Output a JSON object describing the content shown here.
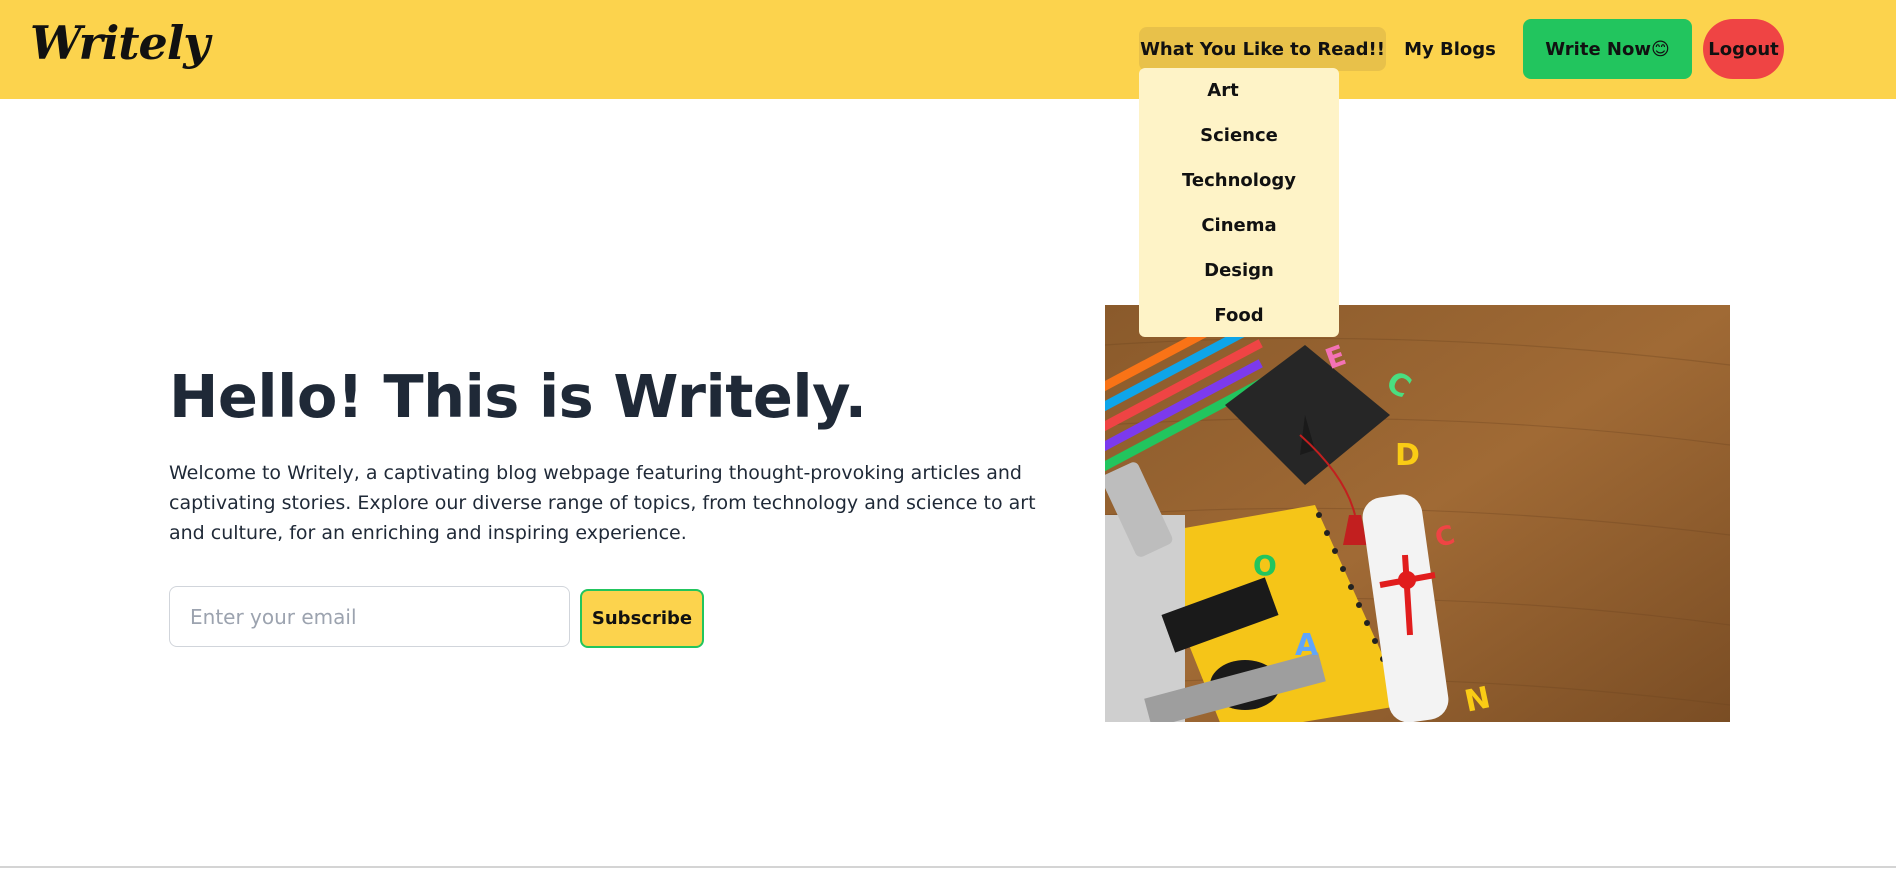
{
  "navbar": {
    "logo": "Writely",
    "dropdown_label": "What You Like to Read!!",
    "my_blogs": "My Blogs",
    "write_now": "Write Now😊",
    "logout": "Logout",
    "bg_color": "#fcd34d"
  },
  "dropdown": {
    "items": [
      "Art",
      "Science",
      "Technology",
      "Cinema",
      "Design",
      "Food"
    ]
  },
  "hero": {
    "title": "Hello! This is Writely.",
    "description": "Welcome to Writely, a captivating blog webpage featuring thought-provoking articles and captivating stories. Explore our diverse range of topics, from technology and science to art and culture, for an enriching and inspiring experience.",
    "email_placeholder": "Enter your email",
    "subscribe": "Subscribe"
  },
  "image": {
    "letters": [
      "E",
      "C",
      "D",
      "C",
      "O",
      "A",
      "N"
    ]
  }
}
